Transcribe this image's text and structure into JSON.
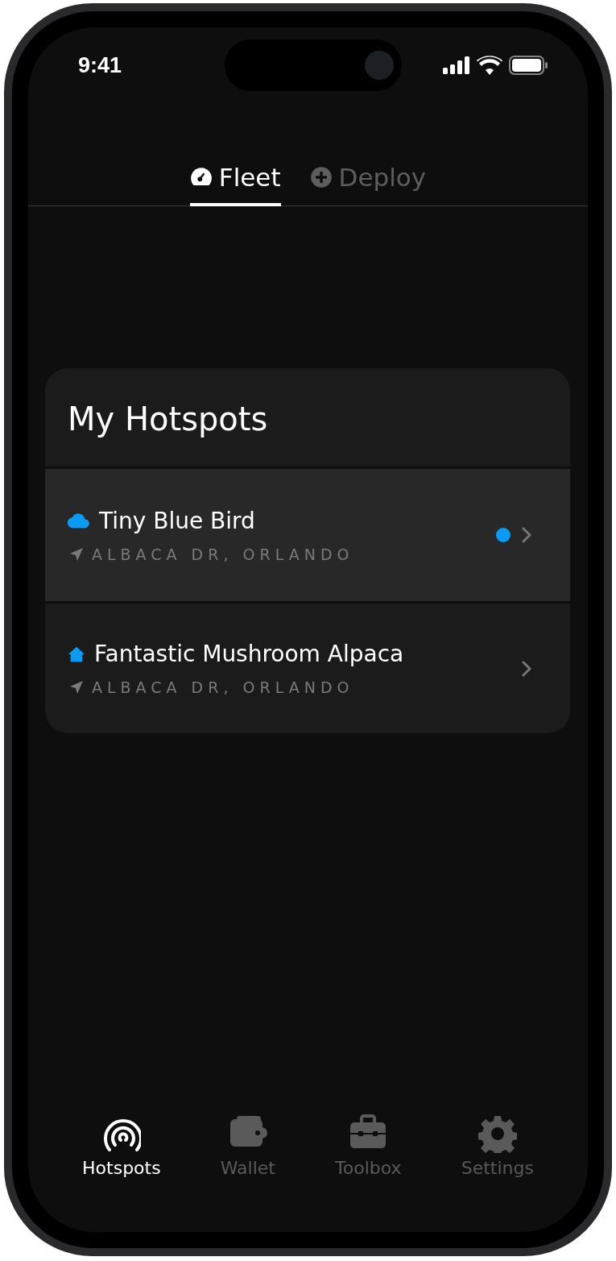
{
  "status_bar": {
    "time": "9:41"
  },
  "tabs": [
    {
      "label": "Fleet",
      "selected": true
    },
    {
      "label": "Deploy",
      "selected": false
    }
  ],
  "hotspots_card": {
    "title": "My Hotspots",
    "items": [
      {
        "name": "Tiny Blue Bird",
        "kind": "cloud",
        "location": "ALBACA DR, ORLANDO",
        "selected": true,
        "color": "#0a9cf5"
      },
      {
        "name": "Fantastic Mushroom Alpaca",
        "kind": "home",
        "location": "ALBACA DR, ORLANDO",
        "selected": false
      }
    ]
  },
  "bottom_nav": [
    {
      "label": "Hotspots",
      "selected": true
    },
    {
      "label": "Wallet",
      "selected": false
    },
    {
      "label": "Toolbox",
      "selected": false
    },
    {
      "label": "Settings",
      "selected": false
    }
  ]
}
